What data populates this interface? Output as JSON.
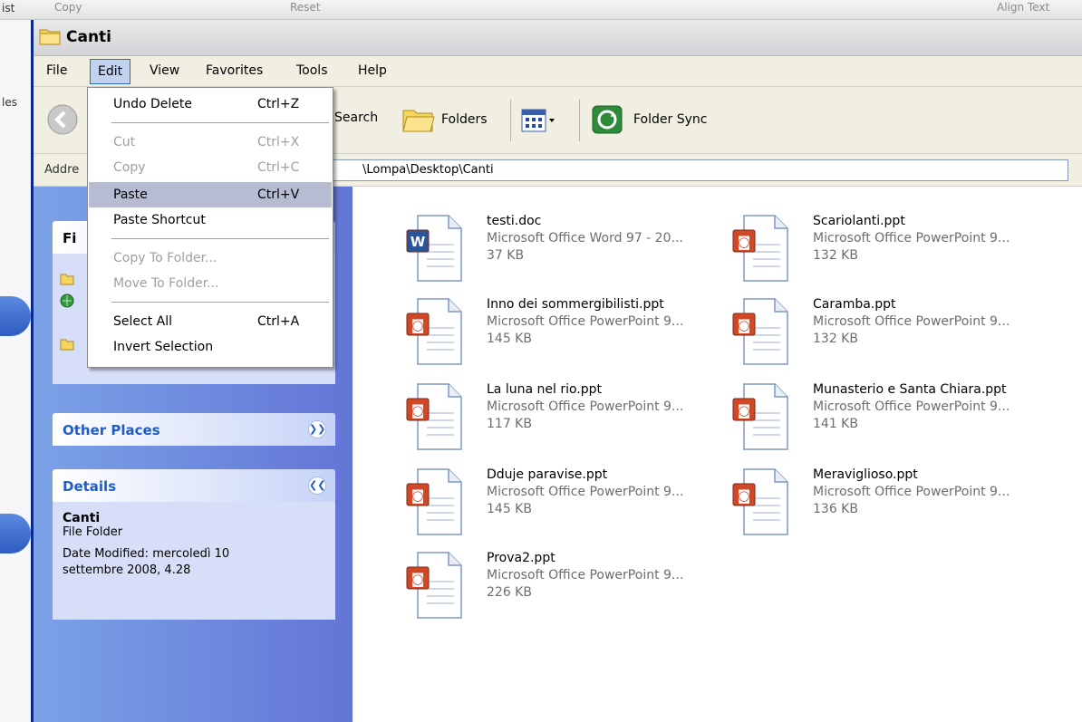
{
  "background": {
    "strip_texts": [
      "Copy",
      "Reset",
      "Align Text"
    ],
    "left_texts": [
      "ist",
      "les"
    ]
  },
  "window": {
    "title": "Canti",
    "menu": [
      "File",
      "Edit",
      "View",
      "Favorites",
      "Tools",
      "Help"
    ],
    "toolbar": {
      "search_label": "Search",
      "folders_label": "Folders",
      "folder_sync_label": "Folder Sync"
    },
    "address": {
      "label": "Addre",
      "path": "\\Lompa\\Desktop\\Canti"
    }
  },
  "edit_menu": {
    "items": [
      {
        "label": "Undo Delete",
        "shortcut": "Ctrl+Z",
        "enabled": true
      },
      {
        "label": "Cut",
        "shortcut": "Ctrl+X",
        "enabled": false
      },
      {
        "label": "Copy",
        "shortcut": "Ctrl+C",
        "enabled": false
      },
      {
        "label": "Paste",
        "shortcut": "Ctrl+V",
        "enabled": true,
        "highlighted": true
      },
      {
        "label": "Paste Shortcut",
        "shortcut": "",
        "enabled": true
      },
      {
        "label": "Copy To Folder...",
        "shortcut": "",
        "enabled": false
      },
      {
        "label": "Move To Folder...",
        "shortcut": "",
        "enabled": false
      },
      {
        "label": "Select All",
        "shortcut": "Ctrl+A",
        "enabled": true
      },
      {
        "label": "Invert Selection",
        "shortcut": "",
        "enabled": true
      }
    ]
  },
  "taskpane": {
    "file_tasks_partial": "Fi",
    "other_places": {
      "title": "Other Places"
    },
    "details": {
      "title": "Details",
      "name": "Canti",
      "type": "File Folder",
      "modified": "Date Modified: mercoledì 10 settembre 2008, 4.28"
    }
  },
  "files": [
    {
      "name": "testi.doc",
      "type": "Microsoft Office Word 97 - 20...",
      "size": "37 KB",
      "kind": "word"
    },
    {
      "name": "Scariolanti.ppt",
      "type": "Microsoft Office PowerPoint 9...",
      "size": "132 KB",
      "kind": "ppt"
    },
    {
      "name": "Inno dei sommergibilisti.ppt",
      "type": "Microsoft Office PowerPoint 9...",
      "size": "145 KB",
      "kind": "ppt"
    },
    {
      "name": "Caramba.ppt",
      "type": "Microsoft Office PowerPoint 9...",
      "size": "132 KB",
      "kind": "ppt"
    },
    {
      "name": "La luna nel rio.ppt",
      "type": "Microsoft Office PowerPoint 9...",
      "size": "117 KB",
      "kind": "ppt"
    },
    {
      "name": "Munasterio e Santa Chiara.ppt",
      "type": "Microsoft Office PowerPoint 9...",
      "size": "141 KB",
      "kind": "ppt"
    },
    {
      "name": "Dduje paravise.ppt",
      "type": "Microsoft Office PowerPoint 9...",
      "size": "145 KB",
      "kind": "ppt"
    },
    {
      "name": "Meraviglioso.ppt",
      "type": "Microsoft Office PowerPoint 9...",
      "size": "136 KB",
      "kind": "ppt"
    },
    {
      "name": "Prova2.ppt",
      "type": "Microsoft Office PowerPoint 9...",
      "size": "226 KB",
      "kind": "ppt"
    }
  ],
  "colors": {
    "taskpane_gradient_start": "#7ba2e7",
    "taskpane_gradient_end": "#6375d6",
    "menu_highlight": "#b6bdd2",
    "pane_title": "#215dc6",
    "ppt_icon": "#d24726",
    "word_icon": "#2a5699"
  }
}
